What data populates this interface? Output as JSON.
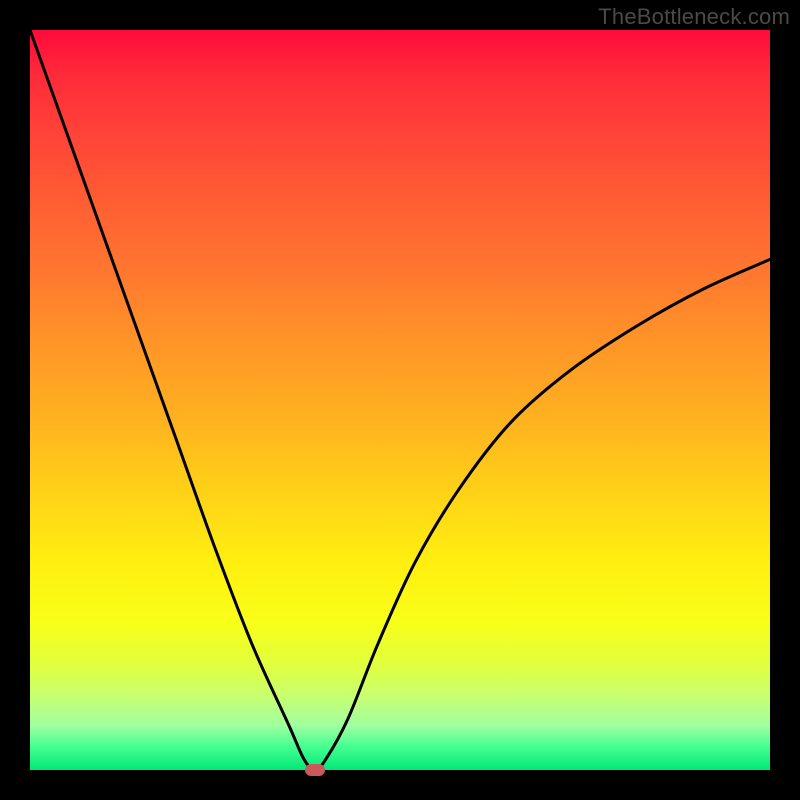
{
  "watermark": "TheBottleneck.com",
  "chart_data": {
    "type": "line",
    "title": "",
    "xlabel": "",
    "ylabel": "",
    "xlim": [
      0,
      100
    ],
    "ylim": [
      0,
      100
    ],
    "grid": false,
    "series": [
      {
        "name": "bottleneck-curve",
        "x": [
          0,
          5,
          10,
          15,
          20,
          25,
          30,
          35,
          37,
          38.5,
          40,
          43,
          47,
          52,
          58,
          65,
          73,
          82,
          91,
          100
        ],
        "y": [
          100,
          86,
          72,
          58,
          44,
          30,
          17,
          6,
          1.5,
          0,
          1.5,
          7,
          17,
          28,
          38,
          47,
          54,
          60,
          65,
          69
        ]
      }
    ],
    "marker": {
      "x": 38.5,
      "y": 0,
      "color": "#c85a5a"
    },
    "background_gradient": {
      "top": "#ff0a3c",
      "bottom": "#00e878"
    }
  }
}
